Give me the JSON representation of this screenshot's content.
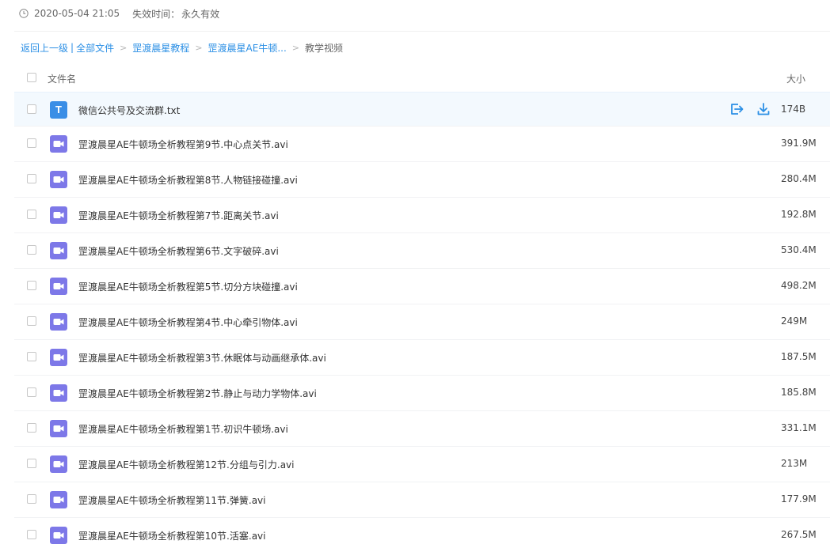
{
  "share": {
    "date": "2020-05-04 21:05",
    "expire_label": "失效时间：",
    "expire_value": "永久有效"
  },
  "breadcrumb": {
    "back": "返回上一级",
    "separator": "|",
    "all_files": "全部文件",
    "level1": "罡渡晨星教程",
    "level2": "罡渡晨星AE牛顿...",
    "current": "教学视频"
  },
  "table": {
    "col_name": "文件名",
    "col_size": "大小"
  },
  "files": [
    {
      "name": "微信公共号及交流群.txt",
      "size": "174B",
      "type": "txt",
      "icon_letter": "T"
    },
    {
      "name": "罡渡晨星AE牛顿场全析教程第9节.中心点关节.avi",
      "size": "391.9M",
      "type": "video"
    },
    {
      "name": "罡渡晨星AE牛顿场全析教程第8节.人物链接碰撞.avi",
      "size": "280.4M",
      "type": "video"
    },
    {
      "name": "罡渡晨星AE牛顿场全析教程第7节.距离关节.avi",
      "size": "192.8M",
      "type": "video"
    },
    {
      "name": "罡渡晨星AE牛顿场全析教程第6节.文字破碎.avi",
      "size": "530.4M",
      "type": "video"
    },
    {
      "name": "罡渡晨星AE牛顿场全析教程第5节.切分方块碰撞.avi",
      "size": "498.2M",
      "type": "video"
    },
    {
      "name": "罡渡晨星AE牛顿场全析教程第4节.中心牵引物体.avi",
      "size": "249M",
      "type": "video"
    },
    {
      "name": "罡渡晨星AE牛顿场全析教程第3节.休眠体与动画继承体.avi",
      "size": "187.5M",
      "type": "video"
    },
    {
      "name": "罡渡晨星AE牛顿场全析教程第2节.静止与动力学物体.avi",
      "size": "185.8M",
      "type": "video"
    },
    {
      "name": "罡渡晨星AE牛顿场全析教程第1节.初识牛顿场.avi",
      "size": "331.1M",
      "type": "video"
    },
    {
      "name": "罡渡晨星AE牛顿场全析教程第12节.分组与引力.avi",
      "size": "213M",
      "type": "video"
    },
    {
      "name": "罡渡晨星AE牛顿场全析教程第11节.弹簧.avi",
      "size": "177.9M",
      "type": "video"
    },
    {
      "name": "罡渡晨星AE牛顿场全析教程第10节.活塞.avi",
      "size": "267.5M",
      "type": "video"
    }
  ],
  "icons": {
    "clock": "clock-icon",
    "txt_file": "txt-file-icon",
    "video_file": "video-file-icon",
    "save": "save-to-netdisk-icon",
    "download": "download-icon"
  },
  "colors": {
    "link": "#2b8fe5",
    "video_icon": "#7d78e8",
    "txt_icon": "#3a8ee6",
    "hover_row": "#f3f9fe"
  }
}
